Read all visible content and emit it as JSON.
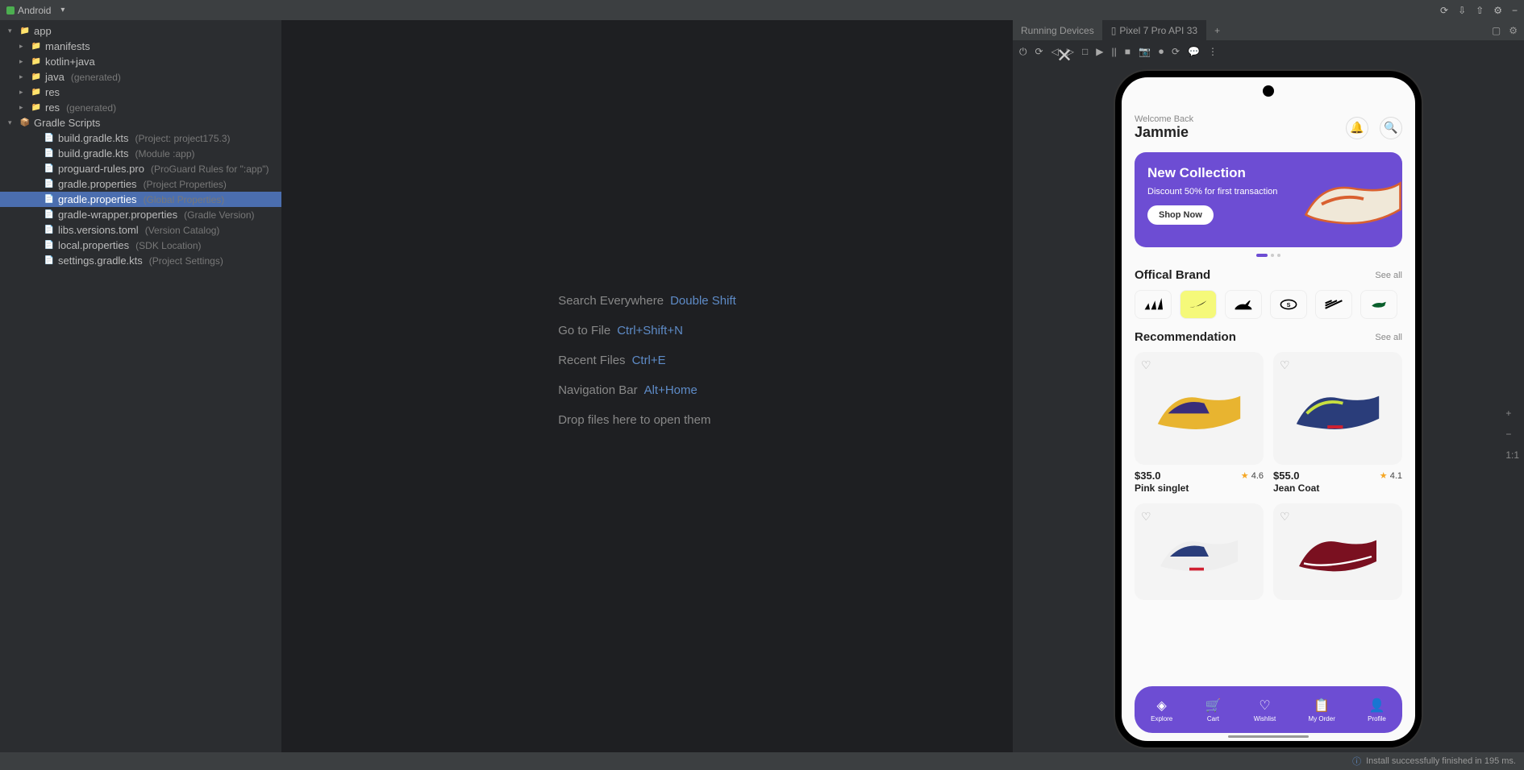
{
  "topbar": {
    "project": "Android",
    "icons": [
      "⟳",
      "⇩",
      "⇧",
      "⚙",
      "−"
    ]
  },
  "tree": {
    "root": "app",
    "items": [
      {
        "indent": 1,
        "label": "manifests",
        "kind": "folder",
        "caret": "▸"
      },
      {
        "indent": 1,
        "label": "kotlin+java",
        "kind": "folder",
        "caret": "▸"
      },
      {
        "indent": 1,
        "label": "java",
        "extra": "(generated)",
        "kind": "folder",
        "caret": "▸"
      },
      {
        "indent": 1,
        "label": "res",
        "kind": "folder",
        "caret": "▸"
      },
      {
        "indent": 1,
        "label": "res",
        "extra": "(generated)",
        "kind": "folder",
        "caret": "▸"
      }
    ],
    "gradle_label": "Gradle Scripts",
    "gradle_items": [
      {
        "label": "build.gradle.kts",
        "extra": "(Project: project175.3)"
      },
      {
        "label": "build.gradle.kts",
        "extra": "(Module :app)"
      },
      {
        "label": "proguard-rules.pro",
        "extra": "(ProGuard Rules for \":app\")"
      },
      {
        "label": "gradle.properties",
        "extra": "(Project Properties)"
      },
      {
        "label": "gradle.properties",
        "extra": "(Global Properties)",
        "selected": true
      },
      {
        "label": "gradle-wrapper.properties",
        "extra": "(Gradle Version)"
      },
      {
        "label": "libs.versions.toml",
        "extra": "(Version Catalog)"
      },
      {
        "label": "local.properties",
        "extra": "(SDK Location)"
      },
      {
        "label": "settings.gradle.kts",
        "extra": "(Project Settings)"
      }
    ]
  },
  "editor": {
    "close": "✕",
    "hints": [
      {
        "label": "Search Everywhere",
        "shortcut": "Double Shift"
      },
      {
        "label": "Go to File",
        "shortcut": "Ctrl+Shift+N"
      },
      {
        "label": "Recent Files",
        "shortcut": "Ctrl+E"
      },
      {
        "label": "Navigation Bar",
        "shortcut": "Alt+Home"
      }
    ],
    "drop": "Drop files here to open them"
  },
  "right": {
    "tab_running": "Running Devices",
    "tab_device": "Pixel 7 Pro API 33",
    "toolbar": [
      "⏻",
      "⟳",
      "◁",
      "▷",
      "□",
      "▶",
      "||",
      "■",
      "📷",
      "⏺",
      "⟳",
      "💬",
      "⋮"
    ],
    "side_tools": [
      "+",
      "−",
      "1:1"
    ]
  },
  "app": {
    "welcome": "Welcome Back",
    "username": "Jammie",
    "banner_title": "New Collection",
    "banner_sub": "Discount 50% for\nfirst transaction",
    "banner_btn": "Shop Now",
    "section_brand": "Offical Brand",
    "section_reco": "Recommendation",
    "see_all": "See all",
    "brands": [
      "adidas",
      "nike",
      "puma",
      "skechers",
      "reebok",
      "lacoste"
    ],
    "products": [
      {
        "price": "$35.0",
        "rating": "4.6",
        "name": "Pink singlet"
      },
      {
        "price": "$55.0",
        "rating": "4.1",
        "name": "Jean Coat"
      }
    ],
    "nav": [
      {
        "icon": "◈",
        "label": "Explore"
      },
      {
        "icon": "🛒",
        "label": "Cart"
      },
      {
        "icon": "♡",
        "label": "Wishlist"
      },
      {
        "icon": "📋",
        "label": "My Order"
      },
      {
        "icon": "👤",
        "label": "Profile"
      }
    ]
  },
  "status": "Install successfully finished in 195 ms."
}
